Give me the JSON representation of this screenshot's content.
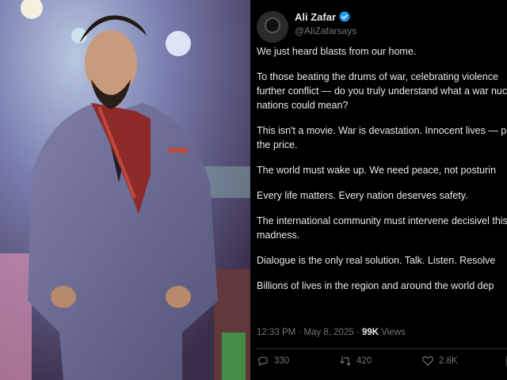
{
  "tweet": {
    "author_name": "Ali Zafar",
    "author_handle": "@AliZafarsays",
    "paragraphs": [
      "We just heard blasts from our home.",
      "To those beating the drums of war, celebrating violence further conflict — do you truly understand what a war nuclear nations could mean?",
      "This isn't a movie. War is devastation. Innocent lives — pay the price.",
      "The world must wake up. We need peace, not posturin",
      "Every life matters. Every nation deserves safety.",
      "The international community must intervene decisivel this madness.",
      "Dialogue is the only real solution. Talk. Listen. Resolve",
      "Billions of lives in the region and around the world dep"
    ],
    "timestamp": "12:33 PM · May 8, 2025 ·",
    "views_count": "99K",
    "views_label": "Views",
    "replies": "330",
    "retweets": "420",
    "likes": "2.8K"
  },
  "colors": {
    "background": "#000000",
    "text": "#e7e9ea",
    "muted": "#71767b",
    "verified": "#1d9bf0"
  },
  "icons": [
    "verified-badge-icon",
    "reply-icon",
    "retweet-icon",
    "like-icon",
    "bookmark-icon"
  ]
}
